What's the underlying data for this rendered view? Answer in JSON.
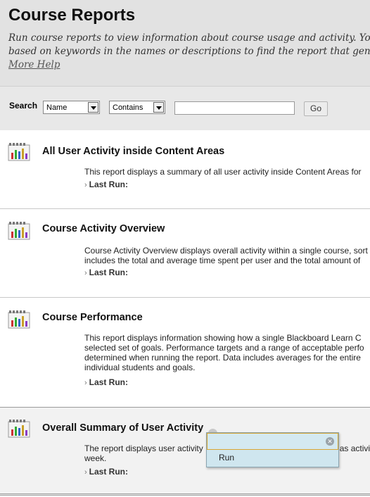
{
  "header": {
    "title": "Course Reports",
    "description_lines": [
      "Run course reports to view information about course usage and activity. You can",
      "based on keywords in the names or descriptions to find the report that generates t"
    ],
    "more_help": "More Help"
  },
  "search": {
    "label": "Search",
    "field_select": "Name",
    "operator_select": "Contains",
    "query_value": "",
    "go_label": "Go"
  },
  "reports": [
    {
      "title": "All User Activity inside Content Areas",
      "description_lines": [
        "This report displays a summary of all user activity inside Content Areas for"
      ],
      "last_run_label": "Last Run:"
    },
    {
      "title": "Course Activity Overview",
      "description_lines": [
        "Course Activity Overview displays overall activity within a single course, sort",
        "includes the total and average time spent per user and the total amount of"
      ],
      "last_run_label": "Last Run:"
    },
    {
      "title": "Course Performance",
      "description_lines": [
        "This report displays information showing how a single Blackboard Learn C",
        "selected set of goals. Performance targets and a range of acceptable perfo",
        "determined when running the report. Data includes averages for the entire",
        "individual students and goals."
      ],
      "last_run_label": "Last Run:"
    },
    {
      "title": "Overall Summary of User Activity",
      "description_lines": [
        "The report displays user activity",
        "week."
      ],
      "description_tail": "as activi",
      "last_run_label": "Last Run:"
    }
  ],
  "context_menu": {
    "items": [
      "Run"
    ]
  }
}
